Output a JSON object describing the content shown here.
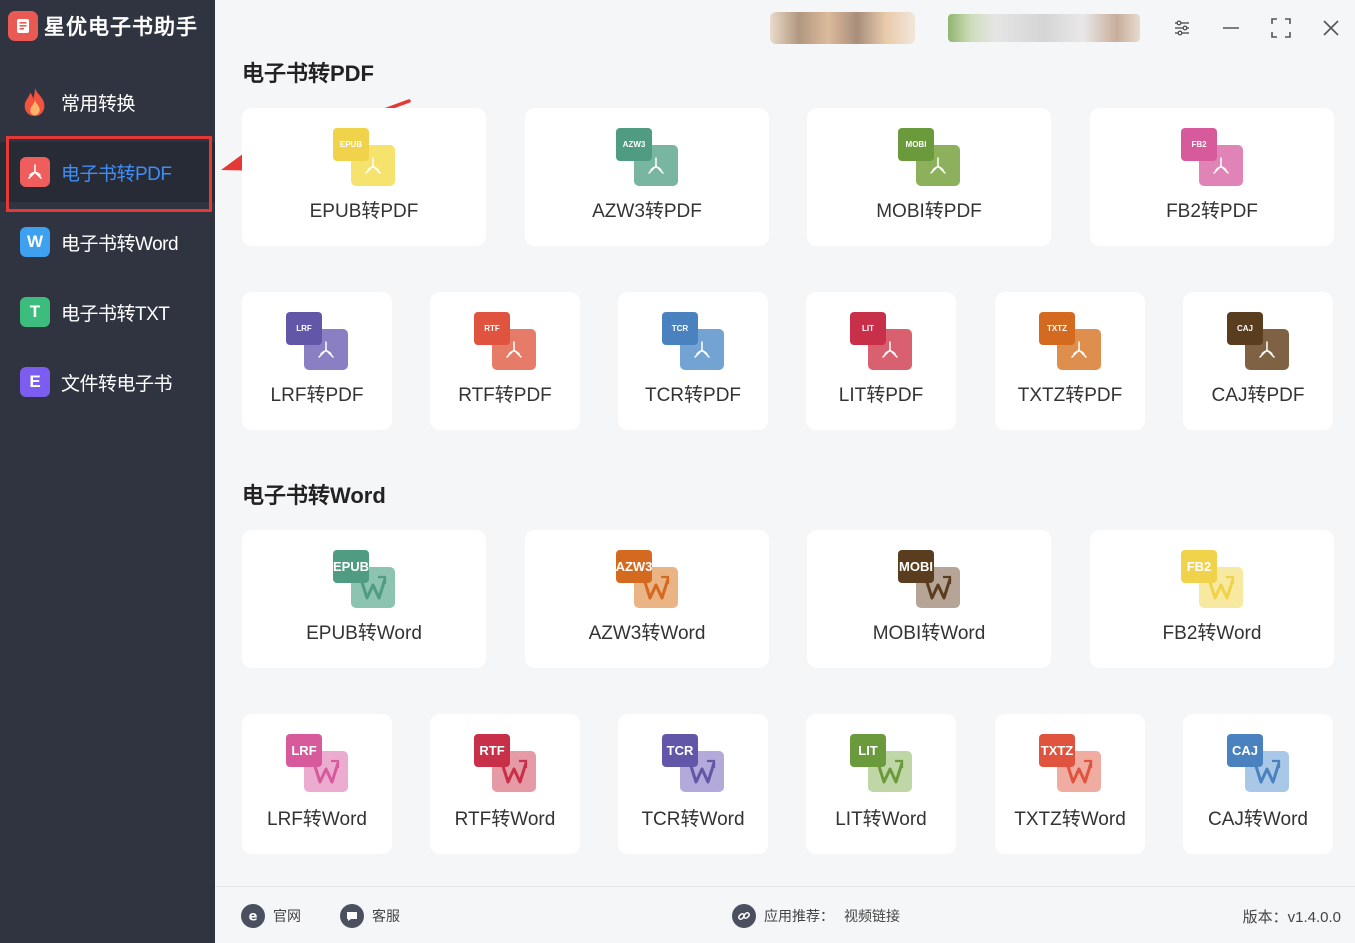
{
  "app": {
    "title": "星优电子书助手"
  },
  "sidebar": {
    "items": [
      {
        "label": "常用转换",
        "icon": "flame-icon"
      },
      {
        "label": "电子书转PDF",
        "icon": "pdf-icon",
        "active": true,
        "color": "#ef5d5d"
      },
      {
        "label": "电子书转Word",
        "icon": "word-icon",
        "glyph": "W",
        "color": "#3ea1f0"
      },
      {
        "label": "电子书转TXT",
        "icon": "txt-icon",
        "glyph": "T",
        "color": "#3dbd7d"
      },
      {
        "label": "文件转电子书",
        "icon": "ebook-icon",
        "glyph": "E",
        "color": "#7d5cf0"
      }
    ]
  },
  "sections": {
    "pdf": {
      "title": "电子书转PDF",
      "cards": [
        {
          "label": "EPUB转PDF",
          "badge": "EPUB",
          "front": "#f0d34a",
          "back": "#f6e36e"
        },
        {
          "label": "AZW3转PDF",
          "badge": "AZW3",
          "front": "#4f9c82",
          "back": "#78b6a2"
        },
        {
          "label": "MOBI转PDF",
          "badge": "MOBI",
          "front": "#6a9a3c",
          "back": "#8cb05c"
        },
        {
          "label": "FB2转PDF",
          "badge": "FB2",
          "front": "#d65a9c",
          "back": "#e083b7"
        },
        {
          "label": "LRF转PDF",
          "badge": "LRF",
          "front": "#6256a8",
          "back": "#8a7fc2"
        },
        {
          "label": "RTF转PDF",
          "badge": "RTF",
          "front": "#e0533f",
          "back": "#e67b68"
        },
        {
          "label": "TCR转PDF",
          "badge": "TCR",
          "front": "#4a82c0",
          "back": "#73a3d3"
        },
        {
          "label": "LIT转PDF",
          "badge": "LIT",
          "front": "#c8304a",
          "back": "#d8606f"
        },
        {
          "label": "TXTZ转PDF",
          "badge": "TXTZ",
          "front": "#d46a1f",
          "back": "#df8f4d"
        },
        {
          "label": "CAJ转PDF",
          "badge": "CAJ",
          "front": "#5a3d1e",
          "back": "#7f6244"
        }
      ]
    },
    "word": {
      "title": "电子书转Word",
      "cards": [
        {
          "label": "EPUB转Word",
          "badge": "EPUB",
          "front": "#4f9c82",
          "back": "#8cc3b1"
        },
        {
          "label": "AZW3转Word",
          "badge": "AZW3",
          "front": "#d46a1f",
          "back": "#ebb485"
        },
        {
          "label": "MOBI转Word",
          "badge": "MOBI",
          "front": "#5a3d1e",
          "back": "#b6a596"
        },
        {
          "label": "FB2转Word",
          "badge": "FB2",
          "front": "#f0d34a",
          "back": "#f7eaa0"
        },
        {
          "label": "LRF转Word",
          "badge": "LRF",
          "front": "#d65a9c",
          "back": "#ecacd0"
        },
        {
          "label": "RTF转Word",
          "badge": "RTF",
          "front": "#c8304a",
          "back": "#e69aa5"
        },
        {
          "label": "TCR转Word",
          "badge": "TCR",
          "front": "#6256a8",
          "back": "#b3aad9"
        },
        {
          "label": "LIT转Word",
          "badge": "LIT",
          "front": "#6a9a3c",
          "back": "#bfd6a6"
        },
        {
          "label": "TXTZ转Word",
          "badge": "TXTZ",
          "front": "#e0533f",
          "back": "#f0aca1"
        },
        {
          "label": "CAJ转Word",
          "badge": "CAJ",
          "front": "#4a82c0",
          "back": "#a9c8e8"
        }
      ]
    }
  },
  "footer": {
    "website": "官网",
    "support": "客服",
    "recommend_label": "应用推荐：",
    "recommend_link": "视频链接",
    "version": "版本：v1.4.0.0"
  },
  "colors": {
    "sidebar_bg": "#2f3440",
    "accent": "#3e8ef7",
    "highlight": "#e53935"
  }
}
